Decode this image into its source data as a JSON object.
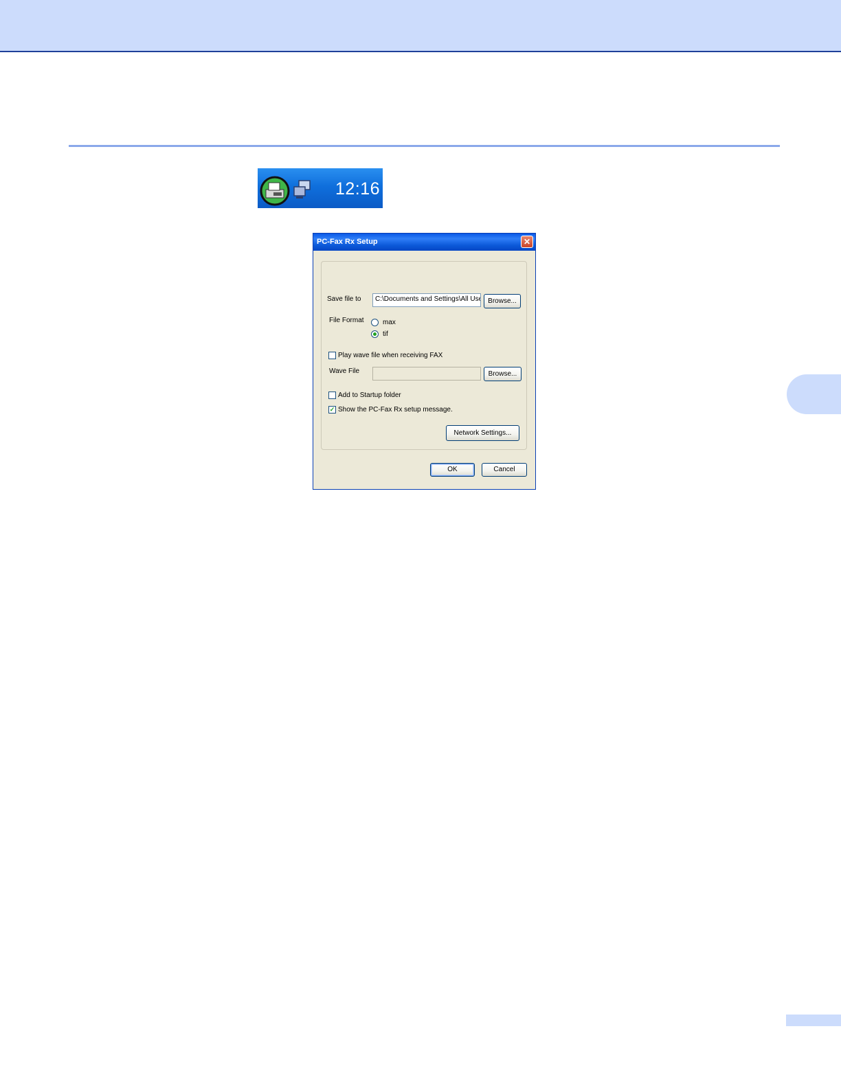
{
  "tray": {
    "clock": "12:16"
  },
  "dialog": {
    "title": "PC-Fax Rx Setup",
    "close_glyph": "✕",
    "save_file_label": "Save file to",
    "save_file_value": "C:\\Documents and Settings\\All Users",
    "browse_label": "Browse...",
    "file_format_label": "File Format",
    "format_options": [
      {
        "label": "max",
        "selected": false
      },
      {
        "label": "tif",
        "selected": true
      }
    ],
    "play_wave_label": "Play wave file when receiving FAX",
    "play_wave_checked": false,
    "wave_file_label": "Wave File",
    "wave_file_value": "",
    "add_startup_label": "Add to Startup folder",
    "add_startup_checked": false,
    "show_message_label": "Show the PC-Fax Rx setup message.",
    "show_message_checked": true,
    "check_mark": "✓",
    "network_settings_label": "Network Settings...",
    "ok_label": "OK",
    "cancel_label": "Cancel"
  }
}
